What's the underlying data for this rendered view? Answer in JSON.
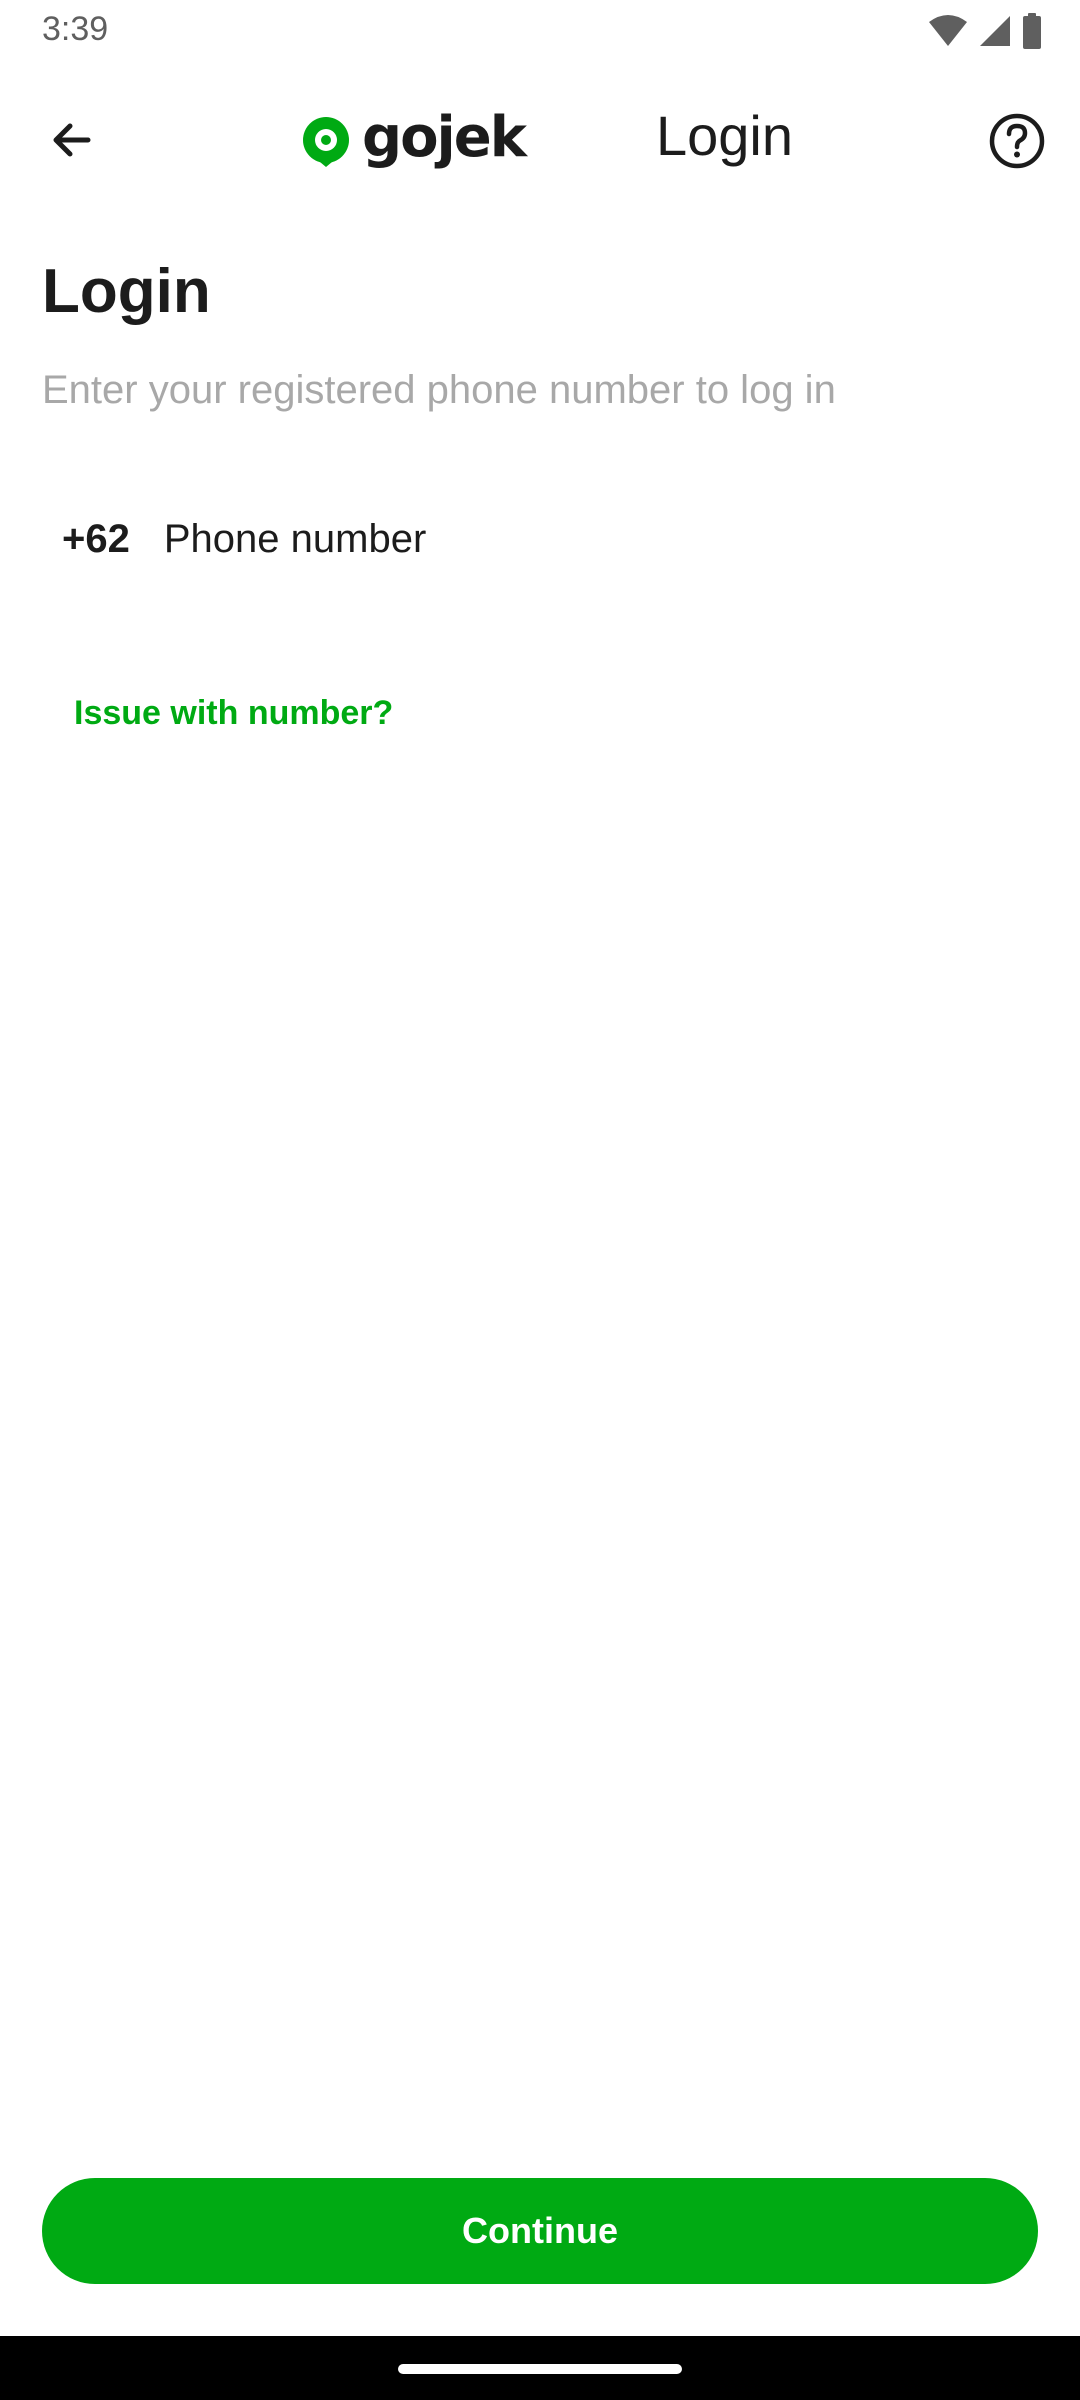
{
  "status_bar": {
    "time": "3:39",
    "icons": [
      "wifi-icon",
      "cellular-signal-icon",
      "battery-icon"
    ]
  },
  "app_bar": {
    "logo_text": "gojek",
    "title": "Login",
    "icons": [
      "arrow-back-icon",
      "help-icon"
    ]
  },
  "main": {
    "title": "Login",
    "subtitle": "Enter your registered phone number to log in",
    "country_code": "+62",
    "phone_placeholder": "Phone number",
    "phone_value": "",
    "issue_link": "Issue with number?"
  },
  "footer": {
    "continue_label": "Continue"
  },
  "colors": {
    "brand_green": "#00aa13",
    "text_primary": "#1c1c1c",
    "text_secondary": "#a8a8a8"
  }
}
